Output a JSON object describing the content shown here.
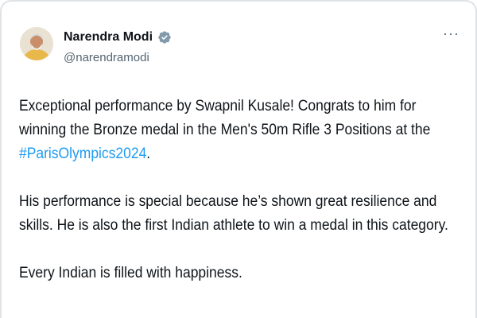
{
  "author": {
    "display_name": "Narendra Modi",
    "handle": "@narendramodi",
    "verified": true,
    "avatar_icon": "profile-photo"
  },
  "more_menu": {
    "label": "···"
  },
  "tweet": {
    "para1_text": "Exceptional performance by Swapnil Kusale! Congrats to him for winning the Bronze medal in the Men's 50m Rifle 3 Positions at the ",
    "hashtag": "#ParisOlympics2024",
    "para1_end": ".",
    "para2": "His performance is special because he’s shown great resilience and skills. He is also the first Indian athlete to win a medal in this category.",
    "para3": "Every Indian is filled with happiness."
  },
  "colors": {
    "hashtag": "#1d9bf0",
    "text": "#0f1419",
    "secondary": "#536471",
    "verified_badge": "#829aab"
  }
}
